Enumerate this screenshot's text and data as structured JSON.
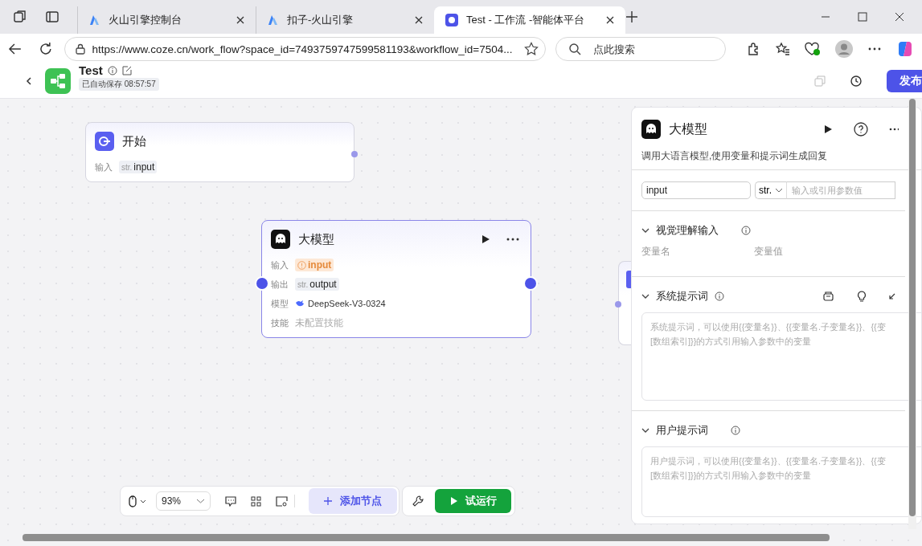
{
  "browser": {
    "tabs": [
      {
        "title": "火山引擎控制台",
        "selected": false
      },
      {
        "title": "扣子-火山引擎",
        "selected": false
      },
      {
        "title": "Test - 工作流 -智能体平台",
        "selected": true
      }
    ],
    "url": "https://www.coze.cn/work_flow?space_id=7493759747599581193&workflow_id=7504...",
    "search": {
      "placeholder": "点此搜索"
    }
  },
  "header": {
    "title": "Test",
    "save_status": "已自动保存 08:57:57",
    "publish_button": "发布"
  },
  "nodes": [
    {
      "kind": "start",
      "title": "开始",
      "selected": false,
      "rows": [
        {
          "kind": "typed",
          "label": "输入",
          "type": "str.",
          "value": "input"
        }
      ]
    },
    {
      "kind": "llm",
      "title": "大模型",
      "selected": true,
      "rows": [
        {
          "kind": "warning",
          "label": "输入",
          "value": "input"
        },
        {
          "kind": "typed",
          "label": "输出",
          "type": "str.",
          "value": "output"
        },
        {
          "kind": "model",
          "label": "模型",
          "value": "DeepSeek-V3-0324"
        },
        {
          "kind": "empty",
          "label": "技能",
          "value": "未配置技能"
        }
      ]
    },
    {
      "kind": "other",
      "selected": false
    }
  ],
  "panel": {
    "title": "大模型",
    "description": "调用大语言模型,使用变量和提示词生成回复",
    "input_row": {
      "name": "input",
      "type": "str.",
      "placeholder": "输入或引用参数值"
    },
    "sections": [
      {
        "kind": "params",
        "title": "视觉理解输入",
        "columns": [
          "变量名",
          "变量值"
        ]
      },
      {
        "kind": "prompt",
        "title": "系统提示词",
        "placeholder_lines": [
          "系统提示词，可以使用{{变量名}}、{{变量名.子变量名}}、{{变",
          "[数组索引]}}的方式引用输入参数中的变量"
        ]
      },
      {
        "kind": "prompt",
        "title": "用户提示词",
        "placeholder_lines": [
          "用户提示词，可以使用{{变量名}}、{{变量名.子变量名}}、{{变",
          "[数组索引]}}的方式引用输入参数中的变量"
        ]
      }
    ]
  },
  "toolbar": {
    "zoom": "93%",
    "add_node": "添加节点",
    "test_run": "试运行"
  }
}
